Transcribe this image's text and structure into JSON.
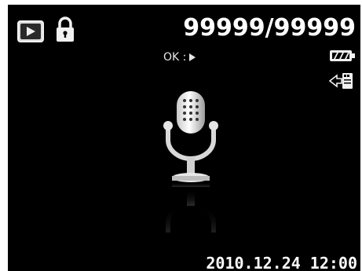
{
  "mode": {
    "playback_icon": "play-mode-icon",
    "protect_icon": "lock-icon"
  },
  "file_counter": "99999/99999",
  "ok_hint": {
    "label": "OK :",
    "icon": "play-triangle-icon"
  },
  "status": {
    "battery_icon": "battery-full-icon",
    "transfer_icon": "transfer-icon"
  },
  "content": {
    "file_type_icon": "microphone-icon"
  },
  "footer": {
    "date": "2010.12.24",
    "time": "12:00"
  },
  "colors": {
    "background": "#000000",
    "text": "#ffffff",
    "icon_light": "#dcdcdc"
  }
}
